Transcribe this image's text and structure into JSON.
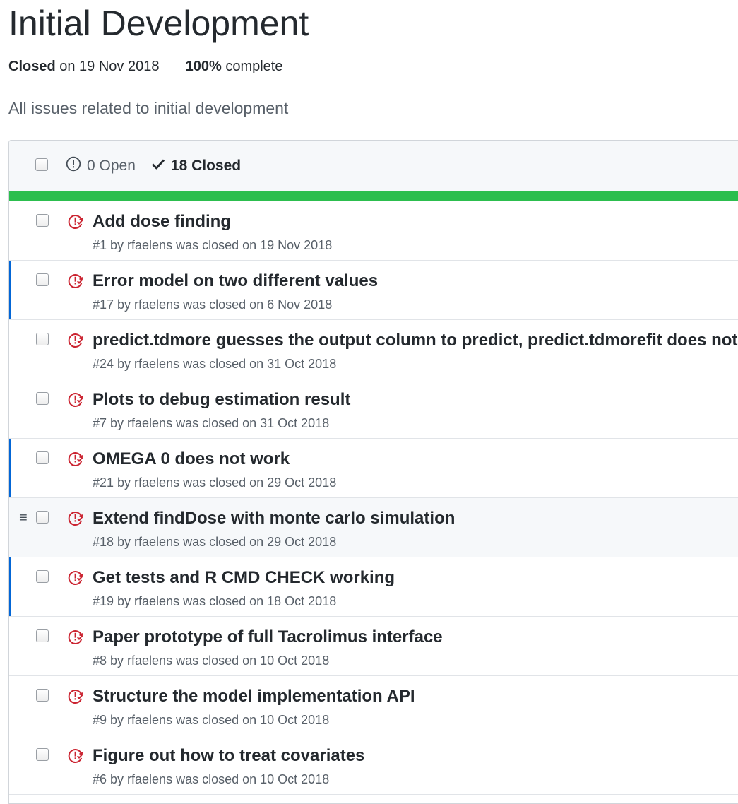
{
  "milestone": {
    "title": "Initial Development",
    "closed_label": "Closed",
    "closed_date_text": "on 19 Nov 2018",
    "percent_label": "100%",
    "complete_label": "complete",
    "description": "All issues related to initial development"
  },
  "states": {
    "open_label": "0 Open",
    "closed_label": "18 Closed"
  },
  "progress": {
    "fraction": 1.0,
    "color": "#2cbe4e"
  },
  "colors": {
    "closed_issue": "#cb2431",
    "accent_bar": "#0366d6"
  },
  "issues": [
    {
      "title": "Add dose finding",
      "meta": "#1 by rfaelens was closed on 19 Nov 2018",
      "bar": false,
      "hover": false
    },
    {
      "title": "Error model on two different values",
      "meta": "#17 by rfaelens was closed on 6 Nov 2018",
      "bar": true,
      "hover": false
    },
    {
      "title": "predict.tdmore guesses the output column to predict, predict.tdmorefit does not",
      "meta": "#24 by rfaelens was closed on 31 Oct 2018",
      "bar": false,
      "hover": false
    },
    {
      "title": "Plots to debug estimation result",
      "meta": "#7 by rfaelens was closed on 31 Oct 2018",
      "bar": false,
      "hover": false
    },
    {
      "title": "OMEGA 0 does not work",
      "meta": "#21 by rfaelens was closed on 29 Oct 2018",
      "bar": true,
      "hover": false
    },
    {
      "title": "Extend findDose with monte carlo simulation",
      "meta": "#18 by rfaelens was closed on 29 Oct 2018",
      "bar": false,
      "hover": true
    },
    {
      "title": "Get tests and R CMD CHECK working",
      "meta": "#19 by rfaelens was closed on 18 Oct 2018",
      "bar": true,
      "hover": false
    },
    {
      "title": "Paper prototype of full Tacrolimus interface",
      "meta": "#8 by rfaelens was closed on 10 Oct 2018",
      "bar": false,
      "hover": false
    },
    {
      "title": "Structure the model implementation API",
      "meta": "#9 by rfaelens was closed on 10 Oct 2018",
      "bar": false,
      "hover": false
    },
    {
      "title": "Figure out how to treat covariates",
      "meta": "#6 by rfaelens was closed on 10 Oct 2018",
      "bar": false,
      "hover": false
    }
  ],
  "drag_handle": "≡"
}
